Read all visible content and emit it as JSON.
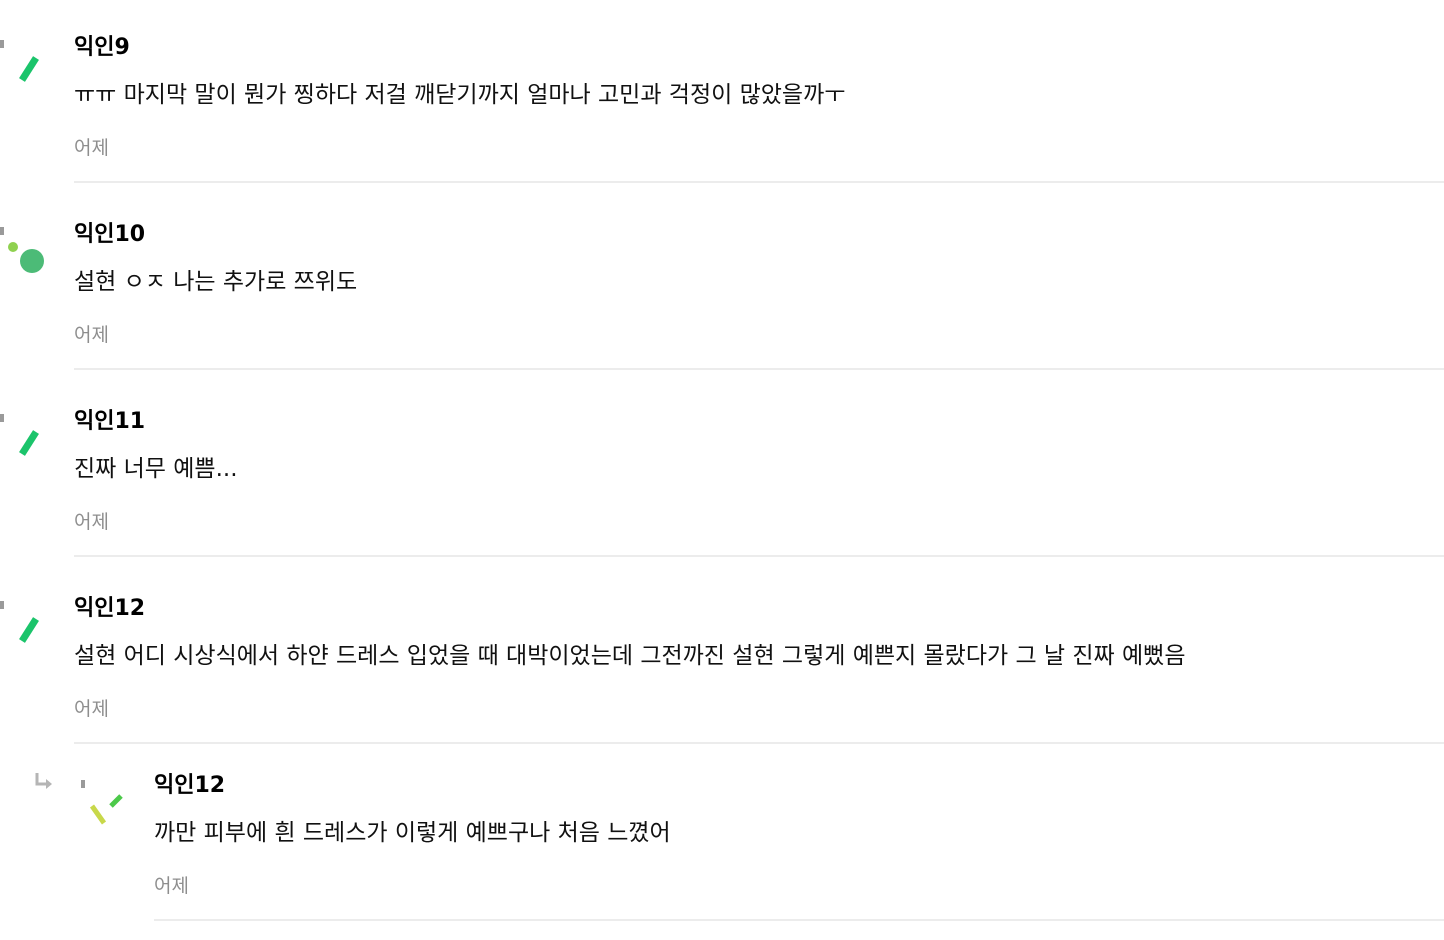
{
  "comments": [
    {
      "author": "익인9",
      "text": "ㅠㅠ 마지막 말이 뭔가 찡하다 저걸 깨닫기까지 얼마나 고민과 걱정이 많았을까ㅜ",
      "time": "어제",
      "avatar_icon": "green-slash-icon",
      "is_reply": false
    },
    {
      "author": "익인10",
      "text": "설현 ㅇㅈ 나는 추가로 쯔위도",
      "time": "어제",
      "avatar_icon": "green-dots-icon",
      "is_reply": false
    },
    {
      "author": "익인11",
      "text": "진짜 너무 예쁨...",
      "time": "어제",
      "avatar_icon": "green-slash-icon",
      "is_reply": false
    },
    {
      "author": "익인12",
      "text": "설현 어디 시상식에서 하얀 드레스 입었을 때 대박이었는데 그전까진 설현 그렇게 예쁜지 몰랐다가 그 날 진짜 예뻤음",
      "time": "어제",
      "avatar_icon": "green-slash-icon",
      "is_reply": false
    },
    {
      "author": "익인12",
      "text": "까만 피부에 흰 드레스가 이렇게 예쁘구나 처음 느꼈어",
      "time": "어제",
      "avatar_icon": "yellow-green-check-icon",
      "is_reply": true
    }
  ],
  "colors": {
    "accent_green": "#1bc46b",
    "light_green": "#8fd14f",
    "yellow_green": "#c8d84a",
    "divider": "#ececec",
    "time_gray": "#8e8e8e"
  }
}
